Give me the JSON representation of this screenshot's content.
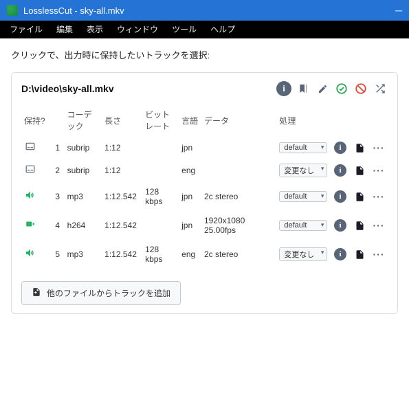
{
  "window": {
    "title": "LosslessCut - sky-all.mkv"
  },
  "menubar": {
    "items": [
      "ファイル",
      "編集",
      "表示",
      "ウィンドウ",
      "ツール",
      "ヘルプ"
    ]
  },
  "instruction": "クリックで、出力時に保持したいトラックを選択:",
  "filepath": "D:\\video\\sky-all.mkv",
  "head_icons": {
    "info": "info-icon",
    "bookmark": "bookmark-icon",
    "edit": "pencil-icon",
    "check": "check-circle-icon",
    "ban": "ban-icon",
    "shuffle": "shuffle-icon"
  },
  "columns": {
    "keep": "保持?",
    "codec": "コーデック",
    "length": "長さ",
    "bitrate": "ビットレート",
    "lang": "言語",
    "data": "データ",
    "disposition": "処理"
  },
  "tracks": [
    {
      "type": "subtitle",
      "index": "1",
      "codec": "subrip",
      "length": "1:12",
      "bitrate": "",
      "lang": "jpn",
      "data": "",
      "disposition": "default"
    },
    {
      "type": "subtitle",
      "index": "2",
      "codec": "subrip",
      "length": "1:12",
      "bitrate": "",
      "lang": "eng",
      "data": "",
      "disposition": "変更なし"
    },
    {
      "type": "audio",
      "index": "3",
      "codec": "mp3",
      "length": "1:12.542",
      "bitrate": "128 kbps",
      "lang": "jpn",
      "data": "2c stereo",
      "disposition": "default"
    },
    {
      "type": "video",
      "index": "4",
      "codec": "h264",
      "length": "1:12.542",
      "bitrate": "",
      "lang": "jpn",
      "data": "1920x1080 25.00fps",
      "disposition": "default"
    },
    {
      "type": "audio",
      "index": "5",
      "codec": "mp3",
      "length": "1:12.542",
      "bitrate": "128 kbps",
      "lang": "eng",
      "data": "2c stereo",
      "disposition": "変更なし"
    }
  ],
  "row_icons": {
    "info": "info-icon",
    "export": "export-icon",
    "more": "more-icon"
  },
  "add_button": "他のファイルからトラックを追加"
}
